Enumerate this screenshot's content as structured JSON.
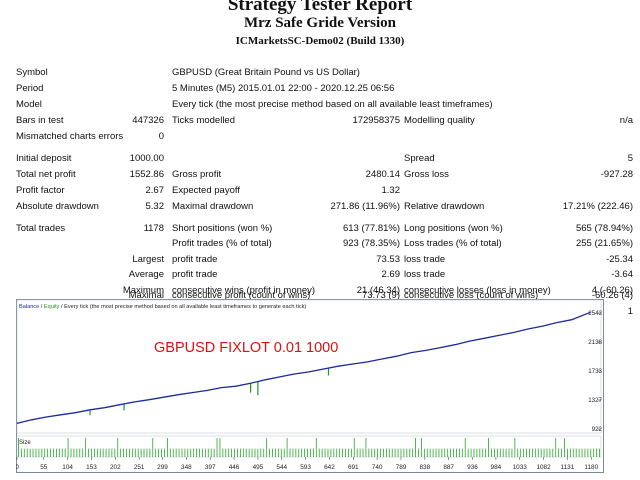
{
  "header": {
    "title": "Strategy Tester Report",
    "subtitle": "Mrz Safe Gride Version",
    "server": "ICMarketsSC-Demo02 (Build 1330)"
  },
  "info": {
    "symbol_label": "Symbol",
    "symbol_value": "GBPUSD (Great Britain Pound vs US Dollar)",
    "period_label": "Period",
    "period_value": "5 Minutes (M5) 2015.01.01 22:00 - 2020.12.25 06:56",
    "model_label": "Model",
    "model_value": "Every tick (the most precise method based on all available least timeframes)",
    "bars_label": "Bars in test",
    "bars_value": "447326",
    "ticks_label": "Ticks modelled",
    "ticks_value": "172958375",
    "quality_label": "Modelling quality",
    "quality_value": "n/a",
    "mismatch_label": "Mismatched charts errors",
    "mismatch_value": "0"
  },
  "results": {
    "initial_deposit_label": "Initial deposit",
    "initial_deposit": "1000.00",
    "spread_label": "Spread",
    "spread": "5",
    "net_profit_label": "Total net profit",
    "net_profit": "1552.86",
    "gross_profit_label": "Gross profit",
    "gross_profit": "2480.14",
    "gross_loss_label": "Gross loss",
    "gross_loss": "-927.28",
    "profit_factor_label": "Profit factor",
    "profit_factor": "2.67",
    "expected_payoff_label": "Expected payoff",
    "expected_payoff": "1.32",
    "abs_dd_label": "Absolute drawdown",
    "abs_dd": "5.32",
    "max_dd_label": "Maximal drawdown",
    "max_dd": "271.86 (11.96%)",
    "rel_dd_label": "Relative drawdown",
    "rel_dd": "17.21% (222.46)"
  },
  "trades": {
    "total_label": "Total trades",
    "total": "1178",
    "short_label": "Short positions (won %)",
    "short": "613 (77.81%)",
    "long_label": "Long positions (won %)",
    "long": "565 (78.94%)",
    "profit_trades_label": "Profit trades (% of total)",
    "profit_trades": "923 (78.35%)",
    "loss_trades_label": "Loss trades (% of total)",
    "loss_trades": "255 (21.65%)",
    "largest_label": "Largest",
    "largest_profit_label": "profit trade",
    "largest_profit": "73.53",
    "largest_loss_label": "loss trade",
    "largest_loss": "-25.34",
    "average_label": "Average",
    "avg_profit_label": "profit trade",
    "avg_profit": "2.69",
    "avg_loss_label": "loss trade",
    "avg_loss": "-3.64",
    "maximum_label": "Maximum",
    "max_cons_wins_label": "consecutive wins (profit in money)",
    "max_cons_wins": "21 (46.34)",
    "max_cons_losses_label": "consecutive losses (loss in money)",
    "max_cons_losses": "4 (-60.26)",
    "maximal_label": "Maximal",
    "maximal_profit_label": "consecutive profit (count of wins)",
    "maximal_profit": "73.73 (9)",
    "maximal_loss_label": "consecutive loss (count of wins)",
    "maximal_loss": "-60.26 (4)",
    "average2_label": "Average",
    "avg_cons_wins_label": "consecutive wins",
    "avg_cons_wins": "5",
    "avg_cons_losses_label": "consecutive losses",
    "avg_cons_losses": "1"
  },
  "chart_data": {
    "type": "line",
    "legend_balance": "Balance",
    "legend_sep": " / ",
    "legend_equity": "Equity",
    "legend_rest": " / Every tick (the most precise method based on all available least timeframes to generate each tick)",
    "annotation": "GBPUSD FIXLOT 0.01 1000",
    "size_label": "Size",
    "ylim": [
      922,
      2543
    ],
    "y_ticks": [
      "2543",
      "2138",
      "1733",
      "1327",
      "922"
    ],
    "y_tick_values": [
      2543,
      2138,
      1733,
      1327,
      922
    ],
    "xlim": [
      0,
      1200
    ],
    "x_ticks": [
      "0",
      "55",
      "104",
      "153",
      "202",
      "251",
      "299",
      "348",
      "397",
      "446",
      "495",
      "544",
      "593",
      "642",
      "691",
      "740",
      "789",
      "838",
      "887",
      "936",
      "984",
      "1033",
      "1082",
      "1131",
      "1180"
    ],
    "x_tick_values": [
      0,
      55,
      104,
      153,
      202,
      251,
      299,
      348,
      397,
      446,
      495,
      544,
      593,
      642,
      691,
      740,
      789,
      838,
      887,
      936,
      984,
      1033,
      1082,
      1131,
      1180
    ],
    "series": [
      {
        "values_x": [
          0,
          30,
          60,
          90,
          120,
          150,
          180,
          210,
          240,
          270,
          300,
          330,
          360,
          390,
          420,
          450,
          480,
          510,
          540,
          570,
          600,
          630,
          660,
          690,
          720,
          750,
          780,
          810,
          840,
          870,
          900,
          930,
          960,
          990,
          1020,
          1050,
          1080,
          1110,
          1140,
          1178
        ],
        "values_y": [
          1000,
          1050,
          1090,
          1120,
          1150,
          1190,
          1220,
          1260,
          1300,
          1330,
          1365,
          1400,
          1430,
          1460,
          1500,
          1520,
          1560,
          1610,
          1650,
          1690,
          1720,
          1760,
          1800,
          1830,
          1860,
          1900,
          1940,
          1990,
          2020,
          2060,
          2100,
          2150,
          2190,
          2230,
          2270,
          2320,
          2360,
          2410,
          2450,
          2553
        ]
      }
    ],
    "equity_dips": [
      {
        "x": 150,
        "y": 1115
      },
      {
        "x": 220,
        "y": 1180
      },
      {
        "x": 480,
        "y": 1430
      },
      {
        "x": 495,
        "y": 1395
      },
      {
        "x": 640,
        "y": 1670
      }
    ],
    "colors": {
      "balance": "#1e2a9a",
      "equity": "#1a9a1a",
      "annotation": "#e01010",
      "volume": "#2ca52c"
    }
  }
}
